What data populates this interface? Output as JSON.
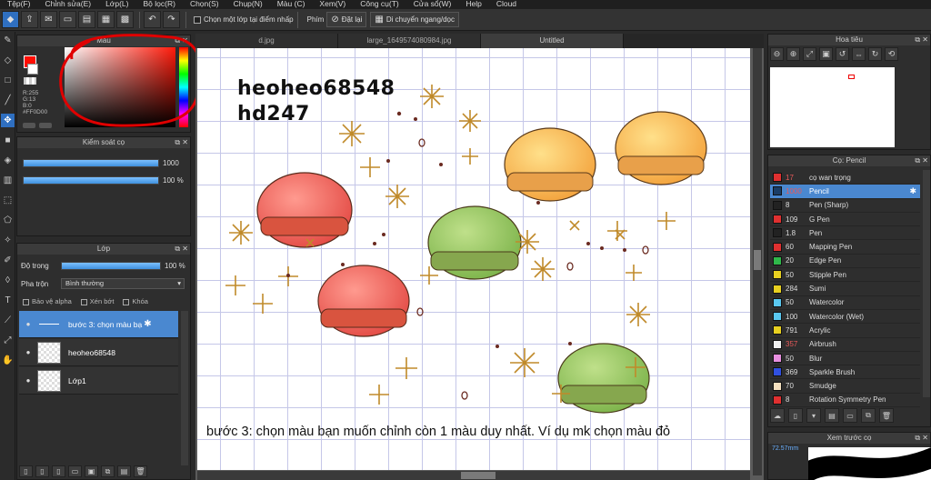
{
  "menu": [
    "Tệp(F)",
    "Chỉnh sửa(E)",
    "Lớp(L)",
    "Bộ lọc(R)",
    "Chọn(S)",
    "Chụp(N)",
    "Màu (C)",
    "Xem(V)",
    "Công cụ(T)",
    "Cửa sổ(W)",
    "Help",
    "Cloud"
  ],
  "toolbar": {
    "single_layer_label": "Chọn một lớp tại điểm nhấp",
    "keys_label": "Phím",
    "reset_label": "Đặt lại",
    "move_label": "Di chuyển ngang/dọc"
  },
  "color_panel": {
    "title": "Màu",
    "rgb": [
      "R:255",
      "G:13",
      "B:0",
      "#FF0D00"
    ],
    "fg_color": "#FF0D00"
  },
  "brush_control": {
    "title": "Kiểm soát cọ",
    "size_value": "1000",
    "opacity_value": "100 %",
    "size_fraction": 1.0,
    "opacity_fraction": 1.0
  },
  "layer_panel": {
    "title": "Lớp",
    "opacity_label": "Độ trong",
    "opacity_value": "100 %",
    "opacity_fraction": 1.0,
    "blend_label": "Pha trộn",
    "blend_value": "Bình thường",
    "alpha_protect": "Bảo vệ alpha",
    "clipping": "Xén bớt",
    "lock": "Khóa",
    "layers": [
      {
        "name": "bước 3: chọn màu bạ",
        "selected": true
      },
      {
        "name": "heoheo68548",
        "selected": false
      },
      {
        "name": "Lớp1",
        "selected": false
      }
    ]
  },
  "tabs": [
    "d.jpg",
    "large_1649574080984.jpg",
    "Untitled"
  ],
  "active_tab": "Untitled",
  "canvas": {
    "signature_line1": "heoheo68548",
    "signature_line2": "hd247",
    "caption": "bước 3: chọn màu bạn muốn chỉnh còn 1 màu duy nhất. Ví dụ mk chọn màu đỏ"
  },
  "navigator": {
    "title": "Hoa tiêu"
  },
  "brush_panel": {
    "title": "Cọ: Pencil",
    "brushes": [
      {
        "size": "17",
        "name": "cọ wan trọng",
        "color": "#e03030",
        "size_red": true,
        "selected": false
      },
      {
        "size": "1000",
        "name": "Pencil",
        "color": "#1a3d66",
        "size_red": true,
        "selected": true
      },
      {
        "size": "8",
        "name": "Pen (Sharp)",
        "color": "#222222",
        "size_red": false,
        "selected": false
      },
      {
        "size": "109",
        "name": "G Pen",
        "color": "#e03030",
        "size_red": false,
        "selected": false
      },
      {
        "size": "1.8",
        "name": "Pen",
        "color": "#222222",
        "size_red": false,
        "selected": false
      },
      {
        "size": "60",
        "name": "Mapping Pen",
        "color": "#e03030",
        "size_red": false,
        "selected": false
      },
      {
        "size": "20",
        "name": "Edge Pen",
        "color": "#2fb84a",
        "size_red": false,
        "selected": false
      },
      {
        "size": "50",
        "name": "Stipple Pen",
        "color": "#e8d020",
        "size_red": false,
        "selected": false
      },
      {
        "size": "284",
        "name": "Sumi",
        "color": "#e8d020",
        "size_red": false,
        "selected": false
      },
      {
        "size": "50",
        "name": "Watercolor",
        "color": "#5ac8f0",
        "size_red": false,
        "selected": false
      },
      {
        "size": "100",
        "name": "Watercolor (Wet)",
        "color": "#5ac8f0",
        "size_red": false,
        "selected": false
      },
      {
        "size": "791",
        "name": "Acrylic",
        "color": "#e8d020",
        "size_red": false,
        "selected": false
      },
      {
        "size": "357",
        "name": "Airbrush",
        "color": "#f0f0f0",
        "size_red": true,
        "selected": false
      },
      {
        "size": "50",
        "name": "Blur",
        "color": "#e890e0",
        "size_red": false,
        "selected": false
      },
      {
        "size": "369",
        "name": "Sparkle Brush",
        "color": "#3050e0",
        "size_red": false,
        "selected": false
      },
      {
        "size": "70",
        "name": "Smudge",
        "color": "#f5e0c0",
        "size_red": false,
        "selected": false
      },
      {
        "size": "8",
        "name": "Rotation Symmetry Pen",
        "color": "#e03030",
        "size_red": false,
        "selected": false
      }
    ]
  },
  "preview_panel": {
    "title": "Xem trước cọ",
    "size_text": "72.57mm"
  }
}
